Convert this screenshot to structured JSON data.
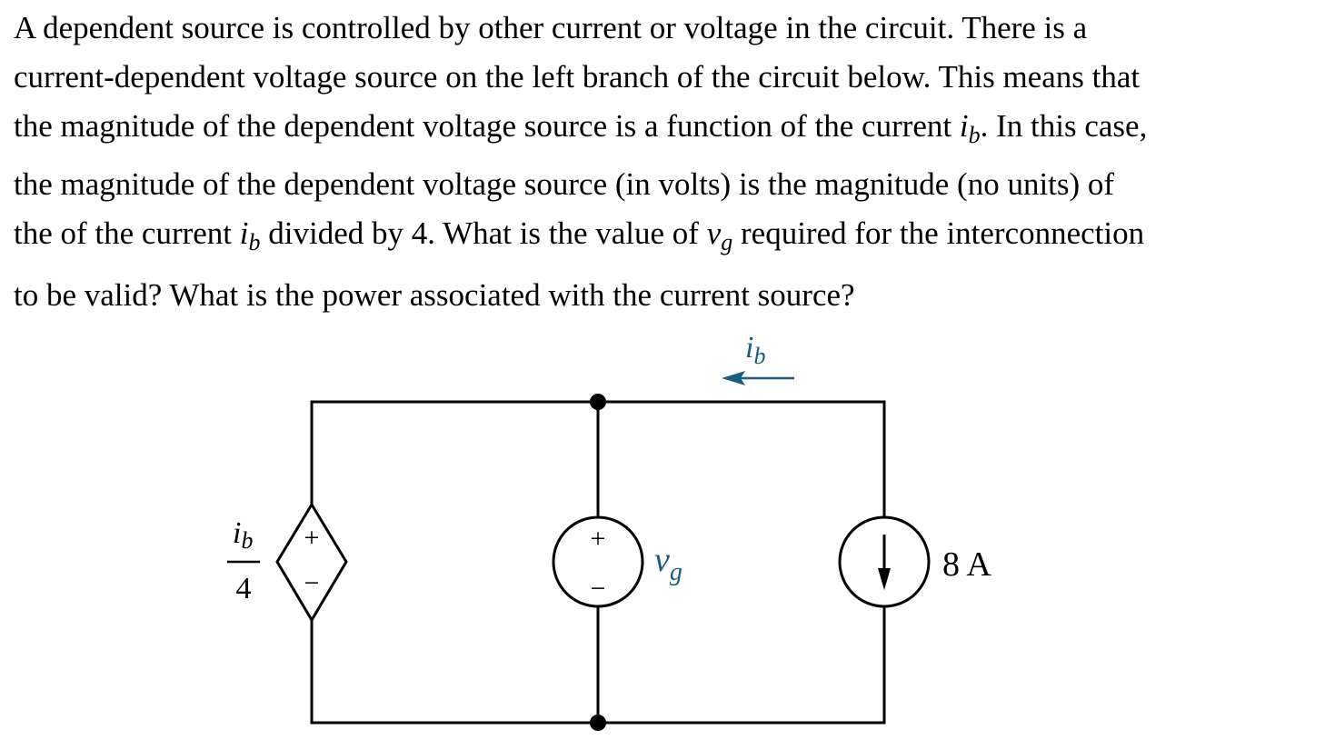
{
  "problem": {
    "lines": [
      {
        "parts": [
          "A dependent source is controlled by other current or voltage in the circuit. There is a"
        ]
      },
      {
        "parts": [
          "current-dependent voltage source on the left branch of the circuit below. This means that"
        ]
      },
      {
        "pre": "the magnitude of the dependent voltage source is a function of the current ",
        "var": "i",
        "sub": "b",
        "post": ". In this case,"
      },
      {
        "parts": [
          "the magnitude of the dependent voltage source (in volts) is the magnitude (no units) of"
        ]
      },
      {
        "pre": "the of the current ",
        "var": "i",
        "sub": "b",
        "mid": " divided by 4. What is the value of ",
        "var2": "v",
        "sub2": "g",
        "post": " required for the interconnection"
      },
      {
        "parts": [
          "to be valid? What is the power associated with the current source?"
        ]
      }
    ]
  },
  "circuit": {
    "colors": {
      "wire": "#000000",
      "annotation": "#1a5c7f"
    },
    "dependent_source": {
      "type": "current-controlled voltage source",
      "label_numerator_var": "i",
      "label_numerator_sub": "b",
      "label_denominator": "4",
      "plus": "+",
      "minus": "−"
    },
    "voltage_source": {
      "label_var": "v",
      "label_sub": "g",
      "plus": "+",
      "minus": "−"
    },
    "current_source": {
      "label": "8 A",
      "direction": "down"
    },
    "current_annotation": {
      "label_var": "i",
      "label_sub": "b",
      "direction": "left"
    }
  }
}
